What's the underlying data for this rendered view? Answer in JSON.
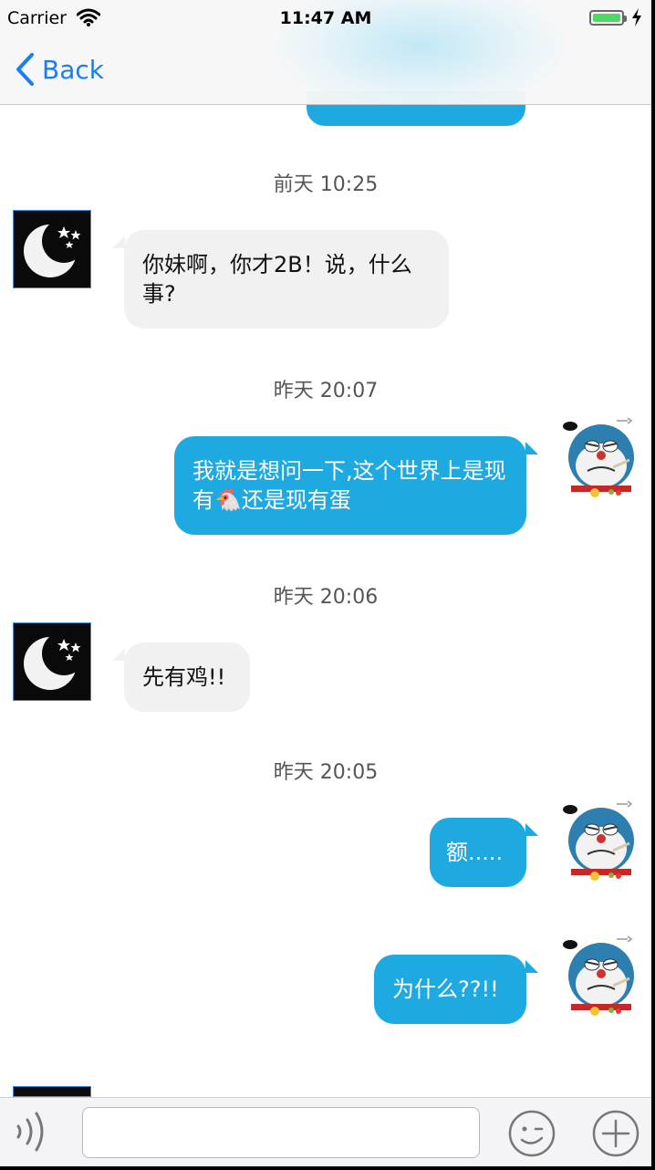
{
  "status_bar": {
    "carrier": "Carrier",
    "time": "11:47 AM"
  },
  "nav": {
    "back_label": "Back"
  },
  "messages": [
    {
      "timestamp": "前天 10:25",
      "direction": "incoming",
      "avatar": "moon-avatar",
      "text": "你妹啊，你才2B！说，什么事?"
    },
    {
      "timestamp": "昨天 20:07",
      "direction": "outgoing",
      "avatar": "doraemon-avatar",
      "text_before_emoji": "我就是想问一下,这个世界上是现有",
      "emoji": "🐔",
      "text_after_emoji": "还是现有蛋"
    },
    {
      "timestamp": "昨天 20:06",
      "direction": "incoming",
      "avatar": "moon-avatar",
      "text": "先有鸡!!"
    },
    {
      "timestamp": "昨天 20:05",
      "direction": "outgoing",
      "avatar": "doraemon-avatar",
      "text": "额....."
    },
    {
      "timestamp": "",
      "direction": "outgoing",
      "avatar": "doraemon-avatar",
      "text": "为什么??!!"
    }
  ],
  "input_bar": {
    "text_value": "",
    "icons": [
      "voice-icon",
      "emoji-icon",
      "plus-icon"
    ]
  },
  "colors": {
    "outgoing_bubble": "#1ea9e1",
    "incoming_bubble": "#f1f1f1",
    "link": "#1a7cf5"
  }
}
